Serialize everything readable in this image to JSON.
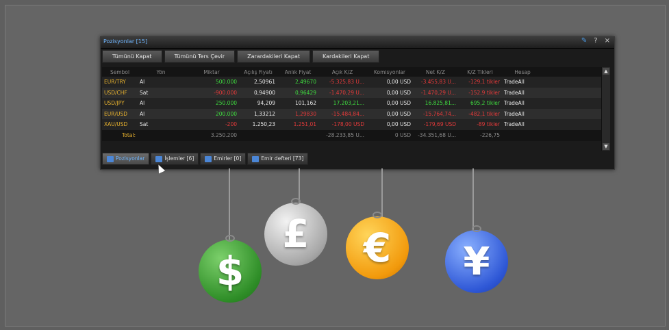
{
  "window": {
    "title": "Pozisyonlar [15]",
    "controls": [
      "✎",
      "?",
      "×"
    ]
  },
  "toolbar": {
    "buttons": [
      "Tümünü Kapat",
      "Tümünü Ters Çevir",
      "Zarardakileri Kapat",
      "Kardakileri Kapat"
    ]
  },
  "table": {
    "columns": [
      "Sembol",
      "Yön",
      "Miktar",
      "Açılış Fiyatı",
      "Anlık Fiyat",
      "Açık K/Z",
      "Komisyonlar",
      "Net K/Z",
      "K/Z Tikleri",
      "Hesap"
    ],
    "rows": [
      {
        "symbol": "EUR/TRY",
        "dir": "Al",
        "qty": "500.000",
        "open": "2,50961",
        "cur": "2,49670",
        "opl": "-5.325,83 U...",
        "comm": "0,00 USD",
        "net": "-3.455,83 U...",
        "ticks": "-129,1 tikler",
        "acct": "TradeAll"
      },
      {
        "symbol": "USD/CHF",
        "dir": "Sat",
        "qty": "-900.000",
        "open": "0,94900",
        "cur": "0,96429",
        "opl": "-1.470,29 U...",
        "comm": "0,00 USD",
        "net": "-1.470,29 U...",
        "ticks": "-152,9 tikler",
        "acct": "TradeAll"
      },
      {
        "symbol": "USD/JPY",
        "dir": "Al",
        "qty": "250.000",
        "open": "94,209",
        "cur": "101,162",
        "opl": "17.203,21...",
        "comm": "0,00 USD",
        "net": "16.825,81...",
        "ticks": "695,2 tikler",
        "acct": "TradeAll"
      },
      {
        "symbol": "EUR/USD",
        "dir": "Al",
        "qty": "200.000",
        "open": "1,33212",
        "cur": "1,29830",
        "opl": "-15.484,84...",
        "comm": "0,00 USD",
        "net": "-15.764,74...",
        "ticks": "-482,1 tikler",
        "acct": "TradeAll"
      },
      {
        "symbol": "XAU/USD",
        "dir": "Sat",
        "qty": "-200",
        "open": "1.250,23",
        "cur": "1.251,01",
        "opl": "-178,00 USD",
        "comm": "0,00 USD",
        "net": "-179,69 USD",
        "ticks": "-89 tikler",
        "acct": "TradeAll"
      }
    ],
    "total": {
      "label": "Total:",
      "qty": "3.250.200",
      "opl": "-28.233,85 U...",
      "comm": "0 USD",
      "net": "-34.351,68 U...",
      "ticks": "-226,75"
    }
  },
  "tabs": [
    "Pozisyonlar",
    "İşlemler [6]",
    "Emirler [0]",
    "Emir defteri [73]"
  ],
  "coins": [
    "$",
    "£",
    "€",
    "¥"
  ]
}
